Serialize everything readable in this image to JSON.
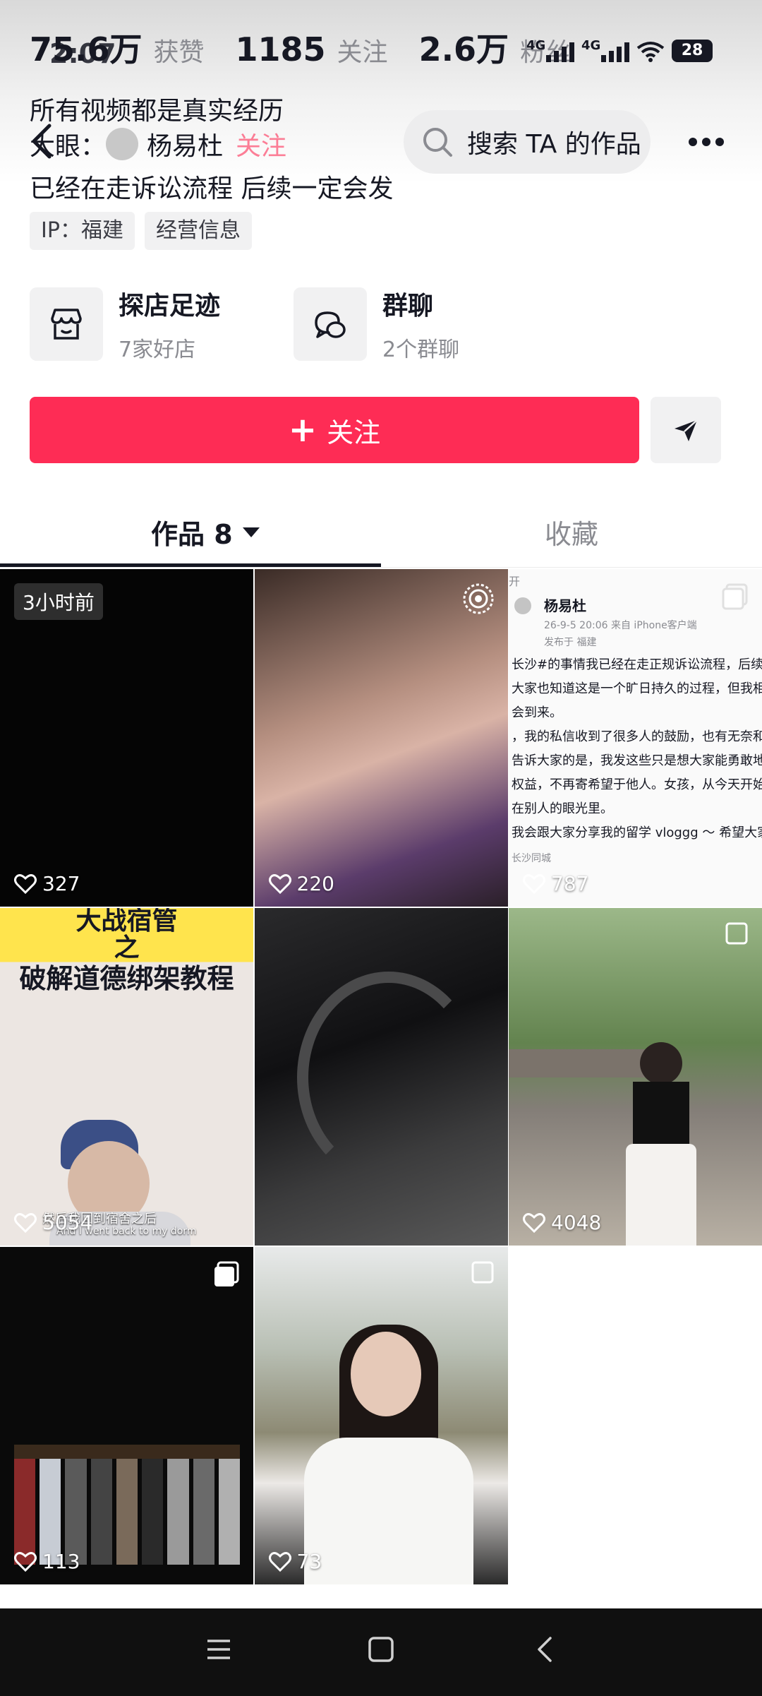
{
  "status_bar": {
    "time": "2:07",
    "battery": "28",
    "network1": "4G",
    "network2": "4G"
  },
  "stats": [
    {
      "value": "75.6万",
      "label": "获赞"
    },
    {
      "value": "1185",
      "label": "关注"
    },
    {
      "value": "2.6万",
      "label": "粉丝"
    }
  ],
  "header": {
    "search_placeholder": "搜索 TA 的作品"
  },
  "bio": {
    "line1": "所有视频都是真实经历",
    "line2_prefix": "大眼：",
    "line2_name": "杨易杜",
    "line2_follow": "关注",
    "line3": "已经在走诉讼流程 后续一定会发"
  },
  "tags": [
    "IP：福建",
    "经营信息"
  ],
  "features": [
    {
      "title": "探店足迹",
      "sub": "7家好店",
      "icon": "store-icon"
    },
    {
      "title": "群聊",
      "sub": "2个群聊",
      "icon": "chat-icon"
    }
  ],
  "follow_button": {
    "label": "关注"
  },
  "tabs": {
    "works": "作品 8",
    "favorites": "收藏"
  },
  "videos": [
    {
      "likes": "327",
      "time_badge": "3小时前"
    },
    {
      "likes": "220"
    },
    {
      "likes": "787",
      "post": {
        "corner": "开",
        "name": "杨易杜",
        "meta": "26-9-5 20:06  来自 iPhone客户端",
        "location": "发布于 福建",
        "lines": [
          "长沙#的事情我已经在走正规诉讼流程，后续一定会",
          "大家也知道这是一个旷日持久的过程，但我相信正",
          "会到来。",
          "，我的私信收到了很多人的鼓励，也有无奈和共鸣",
          "告诉大家的是，我发这些只是想大家能勇敢地争取",
          "权益，不再寄希望于他人。女孩，从今天开始，不",
          "在别人的眼光里。",
          "我会跟大家分享我的留学 vloggg ～ 希望大家天天"
        ],
        "footer": "长沙同城"
      }
    },
    {
      "likes": "5054",
      "banner1": "大战宿管",
      "banner2": "之",
      "banner3": "破解道德绑架教程",
      "subtitle_cn": "然后我回到宿舍之后",
      "subtitle_en": "And I went back to my dorm"
    },
    {
      "likes": ""
    },
    {
      "likes": "4048"
    },
    {
      "likes": "113"
    },
    {
      "likes": "73"
    }
  ]
}
